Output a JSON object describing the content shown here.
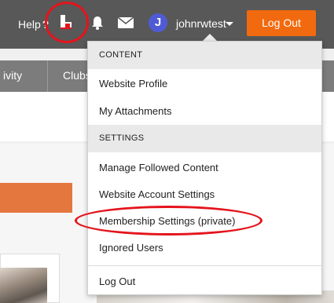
{
  "header": {
    "help_label": "Help",
    "username": "johnrwtest",
    "avatar_initial": "J",
    "logout_label": "Log Out",
    "accent_color": "#f26a0f",
    "icons": [
      "question-icon",
      "brand-b-icon",
      "bell-icon",
      "mail-icon",
      "chevron-down-icon"
    ]
  },
  "nav": {
    "tabs": [
      "ivity",
      "Clubs"
    ]
  },
  "dropdown": {
    "sections": [
      {
        "title": "CONTENT",
        "items": [
          "Website Profile",
          "My Attachments"
        ]
      },
      {
        "title": "SETTINGS",
        "items": [
          "Manage Followed Content",
          "Website Account Settings",
          "Membership Settings (private)",
          "Ignored Users"
        ]
      }
    ],
    "footer_item": "Log Out"
  },
  "annotation_color": "#e4141c"
}
